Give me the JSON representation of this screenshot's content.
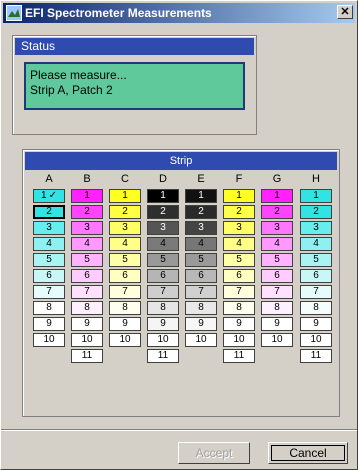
{
  "window": {
    "title": "EFI Spectrometer Measurements"
  },
  "status": {
    "header": "Status",
    "line1": "Please measure...",
    "line2": "Strip A, Patch 2"
  },
  "strip": {
    "header": "Strip",
    "check_mark": "✓",
    "active_cell": "A2",
    "columns": [
      {
        "label": "A",
        "patches": [
          "1",
          "2",
          "3",
          "4",
          "5",
          "6",
          "7",
          "8",
          "9",
          "10"
        ],
        "colors": [
          "#33e3e3",
          "#33e3e3",
          "#66eded",
          "#8ef0f0",
          "#a9f3f3",
          "#c9f6f6",
          "#e6fbfb",
          "#ffffff",
          "#ffffff",
          "#ffffff"
        ]
      },
      {
        "label": "B",
        "patches": [
          "1",
          "2",
          "3",
          "4",
          "5",
          "6",
          "7",
          "8",
          "9",
          "10",
          "11"
        ],
        "colors": [
          "#ff22ff",
          "#ff44ff",
          "#ff77ff",
          "#ff99ff",
          "#ffb3ff",
          "#ffccff",
          "#ffe0ff",
          "#fff0ff",
          "#ffffff",
          "#ffffff",
          "#ffffff"
        ]
      },
      {
        "label": "C",
        "patches": [
          "1",
          "2",
          "3",
          "4",
          "5",
          "6",
          "7",
          "8",
          "9",
          "10"
        ],
        "colors": [
          "#ffff22",
          "#ffff44",
          "#ffff66",
          "#ffff88",
          "#ffffa5",
          "#ffffc2",
          "#ffffdd",
          "#fffff0",
          "#ffffff",
          "#ffffff"
        ]
      },
      {
        "label": "D",
        "patches": [
          "1",
          "2",
          "3",
          "4",
          "5",
          "6",
          "7",
          "8",
          "9",
          "10",
          "11"
        ],
        "colors": [
          "#000000",
          "#2e2e2e",
          "#555555",
          "#7a7a7a",
          "#999999",
          "#b5b5b5",
          "#cecece",
          "#e5e5e5",
          "#f5f5f5",
          "#ffffff",
          "#ffffff"
        ]
      },
      {
        "label": "E",
        "patches": [
          "1",
          "2",
          "3",
          "4",
          "5",
          "6",
          "7",
          "8",
          "9",
          "10"
        ],
        "colors": [
          "#111111",
          "#2a2a2a",
          "#444444",
          "#777777",
          "#9a9a9a",
          "#b8b8b8",
          "#d0d0d0",
          "#e8e8e8",
          "#f7f7f7",
          "#ffffff"
        ]
      },
      {
        "label": "F",
        "patches": [
          "1",
          "2",
          "3",
          "4",
          "5",
          "6",
          "7",
          "8",
          "9",
          "10",
          "11"
        ],
        "colors": [
          "#ffff22",
          "#ffff44",
          "#ffff66",
          "#ffff88",
          "#ffffa5",
          "#ffffc2",
          "#ffffdd",
          "#fffff0",
          "#ffffff",
          "#ffffff",
          "#ffffff"
        ]
      },
      {
        "label": "G",
        "patches": [
          "1",
          "2",
          "3",
          "4",
          "5",
          "6",
          "7",
          "8",
          "9",
          "10"
        ],
        "colors": [
          "#ff22ff",
          "#ff44ff",
          "#ff77ff",
          "#ff99ff",
          "#ffb3ff",
          "#ffccff",
          "#ffe0ff",
          "#fff0ff",
          "#ffffff",
          "#ffffff"
        ]
      },
      {
        "label": "H",
        "patches": [
          "1",
          "2",
          "3",
          "4",
          "5",
          "6",
          "7",
          "8",
          "9",
          "10",
          "11"
        ],
        "colors": [
          "#33e3e3",
          "#33e3e3",
          "#66eded",
          "#8ef0f0",
          "#a9f3f3",
          "#c9f6f6",
          "#e6fbfb",
          "#f5fdfd",
          "#ffffff",
          "#ffffff",
          "#ffffff"
        ]
      }
    ]
  },
  "buttons": {
    "accept": "Accept",
    "cancel": "Cancel"
  },
  "colors": {
    "title_start": "#0a246a",
    "header_blue": "#2f4bb0",
    "status_green": "#5fc99b",
    "window_gray": "#d4d0c8"
  }
}
